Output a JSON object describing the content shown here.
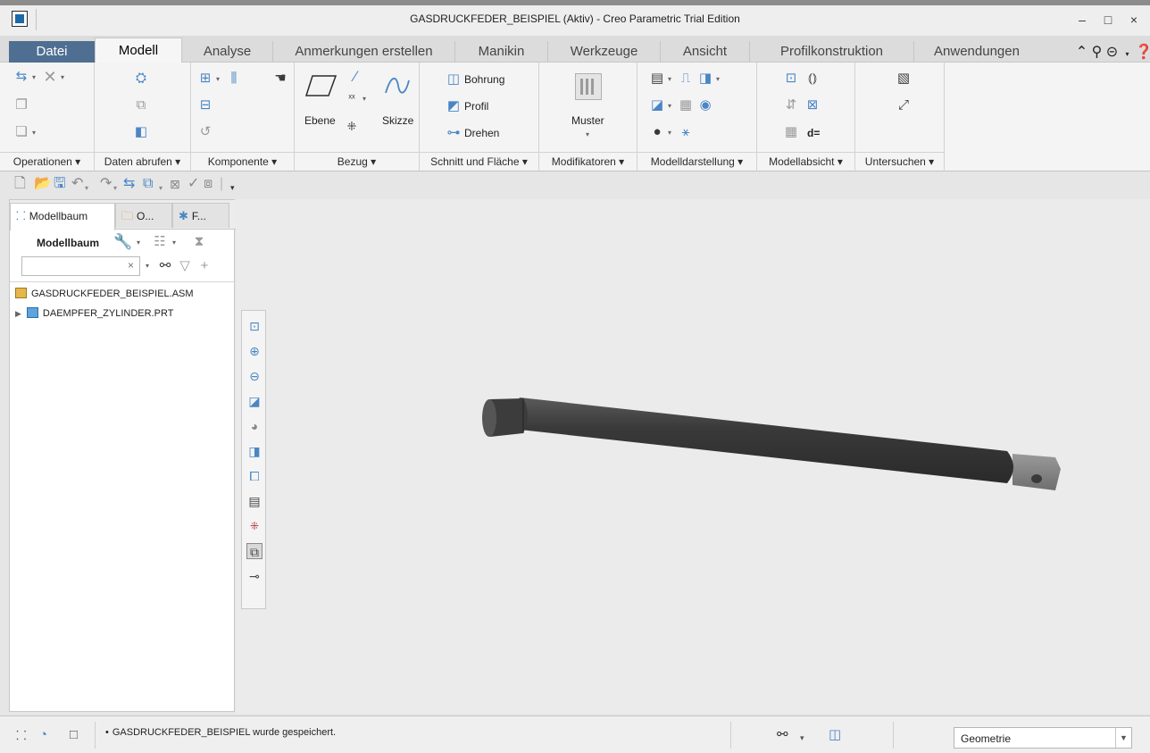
{
  "window": {
    "title": "GASDRUCKFEDER_BEISPIEL (Aktiv) - Creo Parametric Trial Edition",
    "minimize": "–",
    "maximize": "□",
    "close": "×"
  },
  "tabs": [
    {
      "label": "Datei"
    },
    {
      "label": "Modell"
    },
    {
      "label": "Analyse"
    },
    {
      "label": "Anmerkungen erstellen"
    },
    {
      "label": "Manikin"
    },
    {
      "label": "Werkzeuge"
    },
    {
      "label": "Ansicht"
    },
    {
      "label": "Profilkonstruktion"
    },
    {
      "label": "Anwendungen"
    }
  ],
  "ribbon": {
    "groups": [
      {
        "label": "Operationen ▾"
      },
      {
        "label": "Daten abrufen ▾"
      },
      {
        "label": "Komponente ▾"
      },
      {
        "label": "Bezug ▾"
      },
      {
        "label": "Schnitt und Fläche ▾"
      },
      {
        "label": "Modifikatoren ▾"
      },
      {
        "label": "Modelldarstellung ▾"
      },
      {
        "label": "Modellabsicht ▾"
      },
      {
        "label": "Untersuchen ▾"
      }
    ],
    "bezug": {
      "ebene": "Ebene",
      "skizze": "Skizze"
    },
    "schnitt": {
      "bohrung": "Bohrung",
      "profil": "Profil",
      "drehen": "Drehen"
    },
    "modifikatoren": {
      "muster": "Muster"
    },
    "modellabsicht": {
      "d_eq": "d="
    }
  },
  "panel": {
    "tabs": [
      {
        "label": "Modellbaum"
      },
      {
        "label": "O..."
      },
      {
        "label": "F..."
      }
    ],
    "title": "Modellbaum",
    "search": {
      "value": "",
      "placeholder": ""
    },
    "tree": [
      {
        "label": "GASDRUCKFEDER_BEISPIEL.ASM"
      },
      {
        "label": "DAEMPFER_ZYLINDER.PRT"
      }
    ]
  },
  "status": {
    "message": "GASDRUCKFEDER_BEISPIEL wurde gespeichert.",
    "filter": "Geometrie"
  },
  "colors": {
    "accent": "#4a86c5",
    "datei_tab": "#4f6f92",
    "model_body": "#3b3b3b",
    "model_eye": "#8a8a8a"
  }
}
